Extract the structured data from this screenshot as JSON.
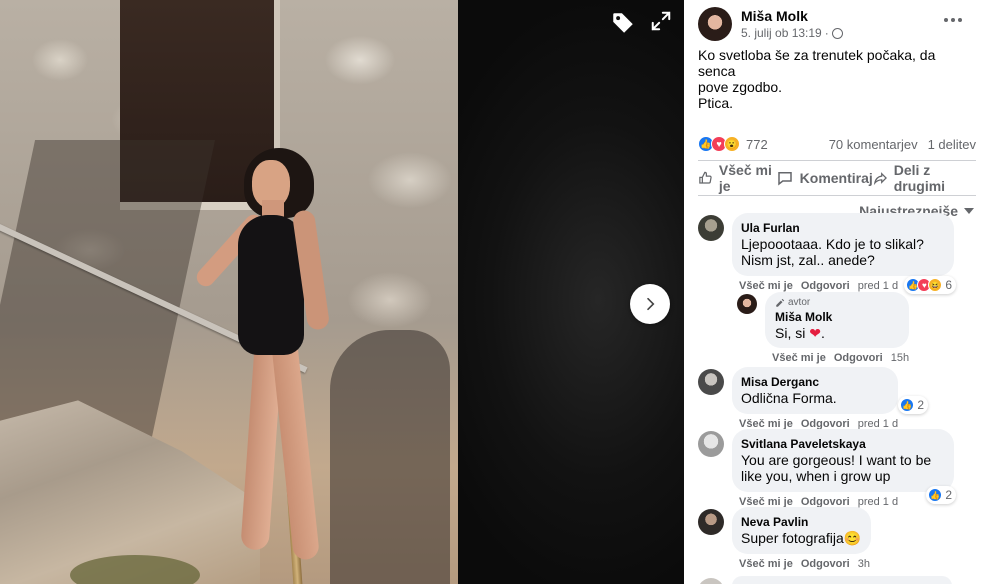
{
  "post": {
    "author": "Miša Molk",
    "timestamp": "5. julij ob 13:19",
    "audience_icon": "globe-icon",
    "text_line1": "Ko svetloba še za trenutek počaka, da senca",
    "text_line2": "pove zgodbo.",
    "text_line3": "Ptica."
  },
  "stats": {
    "reaction_count": "772",
    "comments": "70 komentarjev",
    "shares": "1 delitev"
  },
  "actions": {
    "like": "Všeč mi je",
    "comment": "Komentiraj",
    "share": "Deli z drugimi"
  },
  "sort": {
    "label": "Najustreznejše"
  },
  "comments": [
    {
      "name": "Ula Furlan",
      "text": "Ljepoootaaa. Kdo je to slikal? Nism jst, zal.. anede?",
      "like": "Všeč mi je",
      "reply": "Odgovori",
      "time": "pred 1 d",
      "reactions": "6"
    },
    {
      "badge": "avtor",
      "name": "Miša Molk",
      "text": "Si, si",
      "like": "Všeč mi je",
      "reply": "Odgovori",
      "time": "15h"
    },
    {
      "name": "Misa Derganc",
      "text": "Odlična Forma.",
      "like": "Všeč mi je",
      "reply": "Odgovori",
      "time": "pred 1 d",
      "reactions": "2"
    },
    {
      "name": "Svitlana Paveletskaya",
      "text": "You are gorgeous! I want to be like you, when i grow up",
      "like": "Všeč mi je",
      "reply": "Odgovori",
      "time": "pred 1 d",
      "reactions": "2"
    },
    {
      "name": "Neva Pavlin",
      "text": "Super fotografija",
      "like": "Všeč mi je",
      "reply": "Odgovori",
      "time": "3h"
    }
  ],
  "colors": {
    "like_blue": "#1877f2",
    "love_red": "#f33e58",
    "wow_yellow": "#f7b125",
    "meta_gray": "#65676b",
    "bubble_bg": "#f0f2f5"
  }
}
